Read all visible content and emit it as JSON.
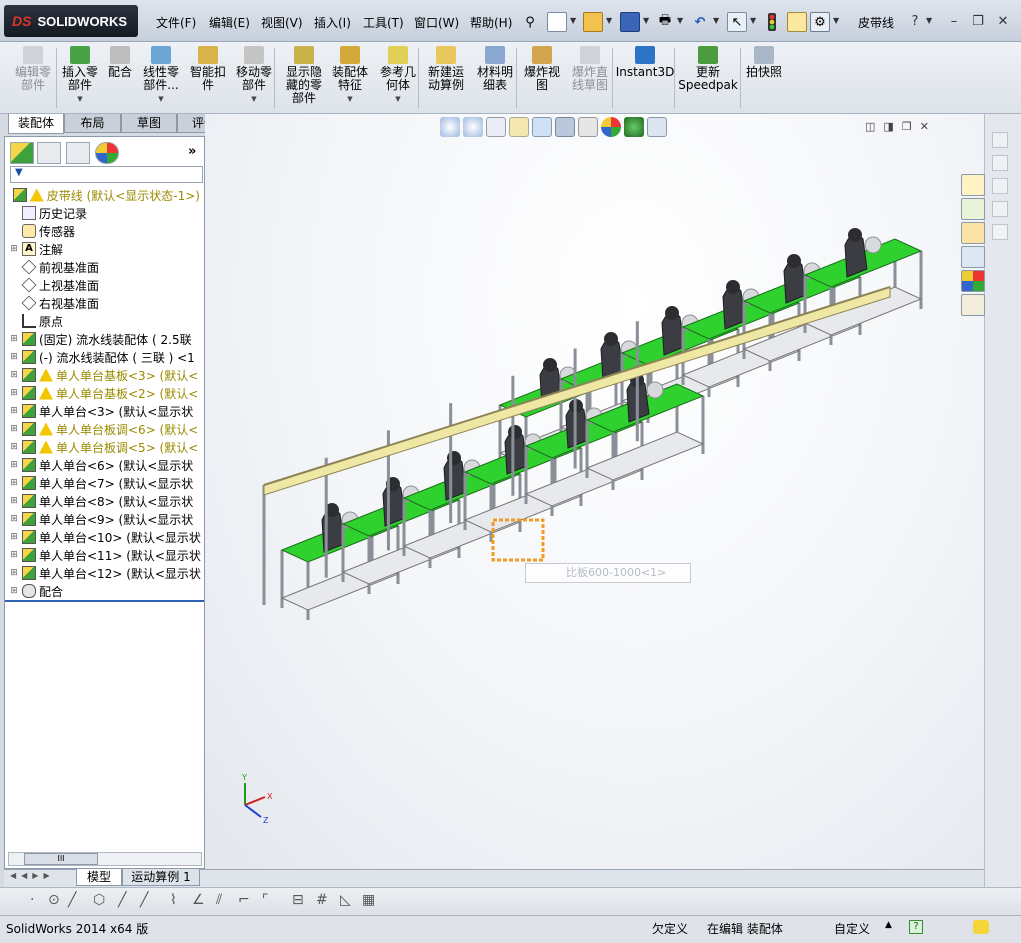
{
  "app": {
    "logo_text": "SOLIDWORKS",
    "logo_prefix": "DS"
  },
  "menu": [
    "文件(F)",
    "编辑(E)",
    "视图(V)",
    "插入(I)",
    "工具(T)",
    "窗口(W)",
    "帮助(H)"
  ],
  "document_title": "皮带线",
  "ribbon": [
    {
      "label": "编辑零\n部件",
      "disabled": true
    },
    {
      "label": "插入零\n部件",
      "dropdown": true
    },
    {
      "label": "配合"
    },
    {
      "label": "线性零\n部件...",
      "dropdown": true
    },
    {
      "label": "智能扣\n件"
    },
    {
      "label": "移动零\n部件",
      "dropdown": true
    },
    {
      "label": "显示隐\n藏的零\n部件"
    },
    {
      "label": "装配体\n特征",
      "dropdown": true
    },
    {
      "label": "参考几\n何体",
      "dropdown": true
    },
    {
      "label": "新建运\n动算例"
    },
    {
      "label": "材料明\n细表"
    },
    {
      "label": "爆炸视\n图"
    },
    {
      "label": "爆炸直\n线草图",
      "disabled": true
    },
    {
      "label": "Instant3D"
    },
    {
      "label": "更新\nSpeedpak"
    },
    {
      "label": "拍快照"
    }
  ],
  "command_tabs": [
    "装配体",
    "布局",
    "草图",
    "评估"
  ],
  "tree": [
    {
      "label": "皮带线  (默认<显示状态-1>)",
      "icon": "assembly",
      "warn": true,
      "root": true
    },
    {
      "label": "历史记录",
      "icon": "history"
    },
    {
      "label": "传感器",
      "icon": "sensor"
    },
    {
      "label": "注解",
      "icon": "annotation",
      "expand": true
    },
    {
      "label": "前视基准面",
      "icon": "plane"
    },
    {
      "label": "上视基准面",
      "icon": "plane"
    },
    {
      "label": "右视基准面",
      "icon": "plane"
    },
    {
      "label": "原点",
      "icon": "origin"
    },
    {
      "label": "(固定) 流水线装配体 ( 2.5联",
      "icon": "assembly",
      "expand": true
    },
    {
      "label": "(-) 流水线装配体 ( 三联 ) <1",
      "icon": "assembly",
      "expand": true
    },
    {
      "label": "单人单台基板<3> (默认<",
      "icon": "assembly",
      "warn": true,
      "expand": true
    },
    {
      "label": "单人单台基板<2> (默认<",
      "icon": "assembly",
      "warn": true,
      "expand": true
    },
    {
      "label": "单人单台<3> (默认<显示状",
      "icon": "assembly",
      "expand": true
    },
    {
      "label": "单人单台板调<6> (默认<",
      "icon": "assembly",
      "warn": true,
      "expand": true
    },
    {
      "label": "单人单台板调<5> (默认<",
      "icon": "assembly",
      "warn": true,
      "expand": true
    },
    {
      "label": "单人单台<6> (默认<显示状",
      "icon": "assembly",
      "expand": true
    },
    {
      "label": "单人单台<7> (默认<显示状",
      "icon": "assembly",
      "expand": true
    },
    {
      "label": "单人单台<8> (默认<显示状",
      "icon": "assembly",
      "expand": true
    },
    {
      "label": "单人单台<9> (默认<显示状",
      "icon": "assembly",
      "expand": true
    },
    {
      "label": "单人单台<10> (默认<显示状",
      "icon": "assembly",
      "expand": true
    },
    {
      "label": "单人单台<11> (默认<显示状",
      "icon": "assembly",
      "expand": true
    },
    {
      "label": "单人单台<12> (默认<显示状",
      "icon": "assembly",
      "expand": true
    },
    {
      "label": "配合",
      "icon": "mate",
      "expand": true
    }
  ],
  "tooltip_text": "比板600-1000<1>",
  "axis_labels": {
    "x": "X",
    "y": "Y",
    "z": "Z"
  },
  "bottom_tabs": [
    "模型",
    "运动算例 1"
  ],
  "status": {
    "version": "SolidWorks 2014 x64 版",
    "defined": "欠定义",
    "editing": "在编辑 装配体",
    "custom": "自定义"
  },
  "colors": {
    "table_green": "#2fd12f",
    "frame": "#8a8f98",
    "rail_yellow": "#efe7a4",
    "accent_orange": "#f39b24"
  }
}
